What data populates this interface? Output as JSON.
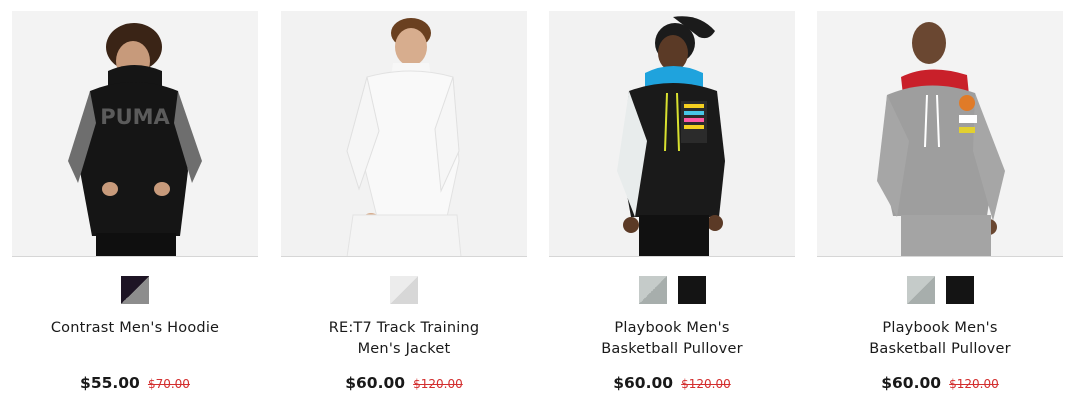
{
  "products": [
    {
      "name_lines": [
        "Contrast Men's Hoodie",
        ""
      ],
      "price": "$55.00",
      "original_price": "$70.00",
      "image_icon": "model-black-hoodie-image",
      "swatches": [
        {
          "color_a": "#1d1424",
          "color_b": "#8d8d8d"
        }
      ]
    },
    {
      "name_lines": [
        "RE:T7 Track Training",
        "Men's Jacket"
      ],
      "price": "$60.00",
      "original_price": "$120.00",
      "image_icon": "model-white-jacket-image",
      "swatches": [
        {
          "color_a": "#ececec",
          "color_b": "#d7d7d7"
        }
      ]
    },
    {
      "name_lines": [
        "Playbook Men's",
        "Basketball Pullover"
      ],
      "price": "$60.00",
      "original_price": "$120.00",
      "image_icon": "model-black-pullover-image",
      "swatches": [
        {
          "color_a": "#c5cbc9",
          "color_b": "#a7aeac"
        },
        {
          "color_a": "#141414",
          "color_b": "#141414"
        }
      ]
    },
    {
      "name_lines": [
        "Playbook Men's",
        "Basketball Pullover"
      ],
      "price": "$60.00",
      "original_price": "$120.00",
      "image_icon": "model-grey-pullover-image",
      "swatches": [
        {
          "color_a": "#c5cbc9",
          "color_b": "#a7aeac"
        },
        {
          "color_a": "#141414",
          "color_b": "#141414"
        }
      ]
    }
  ],
  "colors": {
    "sale_price": "#d32f2f",
    "price": "#191919",
    "image_bg": "#f1f1f1"
  }
}
